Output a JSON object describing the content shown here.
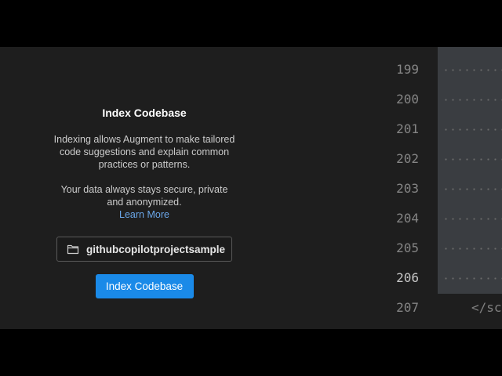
{
  "panel": {
    "title": "Index Codebase",
    "description": "Indexing allows Augment to make tailored code suggestions and explain common practices or patterns.",
    "privacy": "Your data always stays secure, private and anonymized.",
    "learn_more": "Learn More",
    "folder_icon": "folder-icon",
    "folder_name": "githubcopilotprojectsample",
    "index_button": "Index Codebase",
    "button_color": "#1a8ae8",
    "link_color": "#6aa6e8"
  },
  "editor": {
    "line_numbers": [
      "199",
      "200",
      "201",
      "202",
      "203",
      "204",
      "205",
      "206",
      "207"
    ],
    "active_line": "206",
    "last_line_code": "</sc",
    "selection_color": "#3a3d41"
  }
}
